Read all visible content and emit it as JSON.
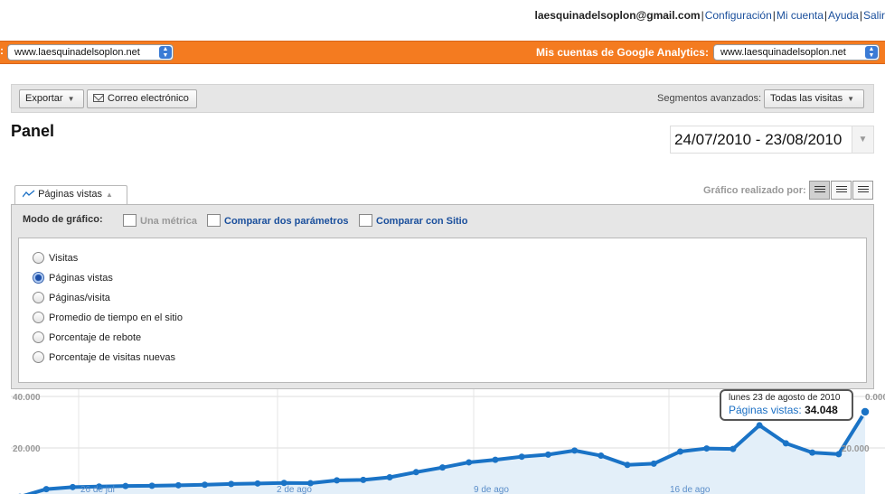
{
  "user": {
    "email": "laesquinadelsoplon@gmail.com",
    "links": [
      "Configuración",
      "Mi cuenta",
      "Ayuda",
      "Salir"
    ]
  },
  "topbar": {
    "lead_char": ":",
    "site_select": "www.laesquinadelsoplon.net",
    "accounts_label": "Mis cuentas de Google Analytics:",
    "accounts_select": "www.laesquinadelsoplon.net",
    "accent_color": "#f47b20"
  },
  "toolbar": {
    "export_label": "Exportar",
    "email_label": "Correo electrónico",
    "segments_label": "Segmentos avanzados:",
    "segments_value": "Todas las visitas"
  },
  "page": {
    "title": "Panel",
    "date_range": "24/07/2010 - 23/08/2010"
  },
  "graph": {
    "tab_label": "Páginas vistas",
    "graph_by_label": "Gráfico realizado por:",
    "mode_label": "Modo de gráfico:",
    "modes": [
      "Una métrica",
      "Comparar dos parámetros",
      "Comparar con Sitio"
    ],
    "metrics": [
      "Visitas",
      "Páginas vistas",
      "Páginas/visita",
      "Promedio de tiempo en el sitio",
      "Porcentaje de rebote",
      "Porcentaje de visitas nuevas"
    ],
    "selected_metric": 1
  },
  "tooltip": {
    "date": "lunes 23 de agosto de 2010",
    "metric_label": "Páginas vistas:",
    "metric_value": "34.048"
  },
  "chart_data": {
    "type": "area",
    "series": [
      {
        "name": "Páginas vistas",
        "color": "#1a73c6",
        "values": [
          1000,
          4000,
          4800,
          5000,
          5200,
          5300,
          5500,
          5700,
          6000,
          6200,
          6400,
          6300,
          7400,
          7600,
          8600,
          10600,
          12400,
          14400,
          15400,
          16600,
          17400,
          19000,
          17000,
          13400,
          13900,
          18600,
          19800,
          19600,
          28800,
          21800,
          18200,
          17600,
          34048
        ]
      }
    ],
    "y_ticks_left": [
      "40.000",
      "20.000"
    ],
    "y_tick_right": [
      "20.000"
    ],
    "x_tick_labels": [
      "26 de jul",
      "2 de ago",
      "9 de ago",
      "16 de ago"
    ],
    "ylim": [
      0,
      40000
    ],
    "grid": true
  }
}
